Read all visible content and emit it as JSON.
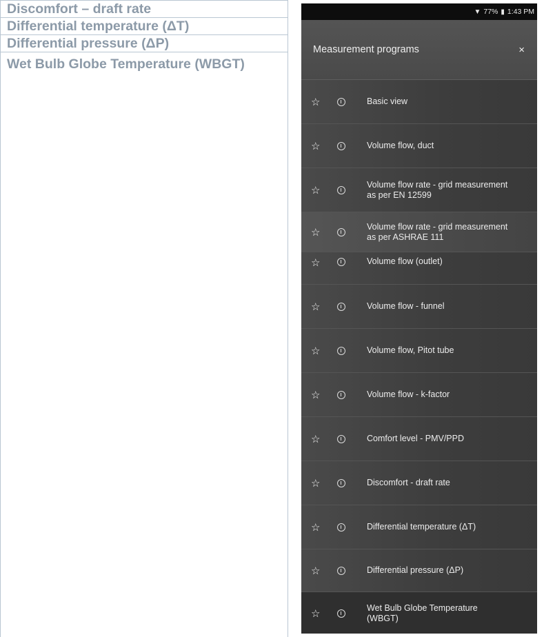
{
  "doc_rows": [
    "Discomfort – draft rate",
    "Differential temperature (ΔT)",
    "Differential pressure (ΔP)",
    "Wet Bulb Globe Temperature (WBGT)"
  ],
  "status_bar": {
    "signal": "▼",
    "battery": "77%",
    "battery_icon": "▮",
    "time": "1:43 PM"
  },
  "header": {
    "title": "Measurement programs",
    "close": "×"
  },
  "icons": {
    "star": "☆"
  },
  "programs": [
    "Basic view",
    "Volume flow, duct",
    "Volume flow rate - grid measurement as per EN 12599",
    "Volume flow rate - grid measurement as per ASHRAE 111",
    "Volume flow (outlet)",
    "Volume flow - funnel",
    "Volume flow, Pitot tube",
    "Volume flow - k-factor",
    "Comfort level - PMV/PPD",
    "Discomfort - draft rate",
    "Differential temperature (ΔT)",
    "Differential pressure (ΔP)",
    "Wet Bulb Globe Temperature (WBGT)"
  ]
}
